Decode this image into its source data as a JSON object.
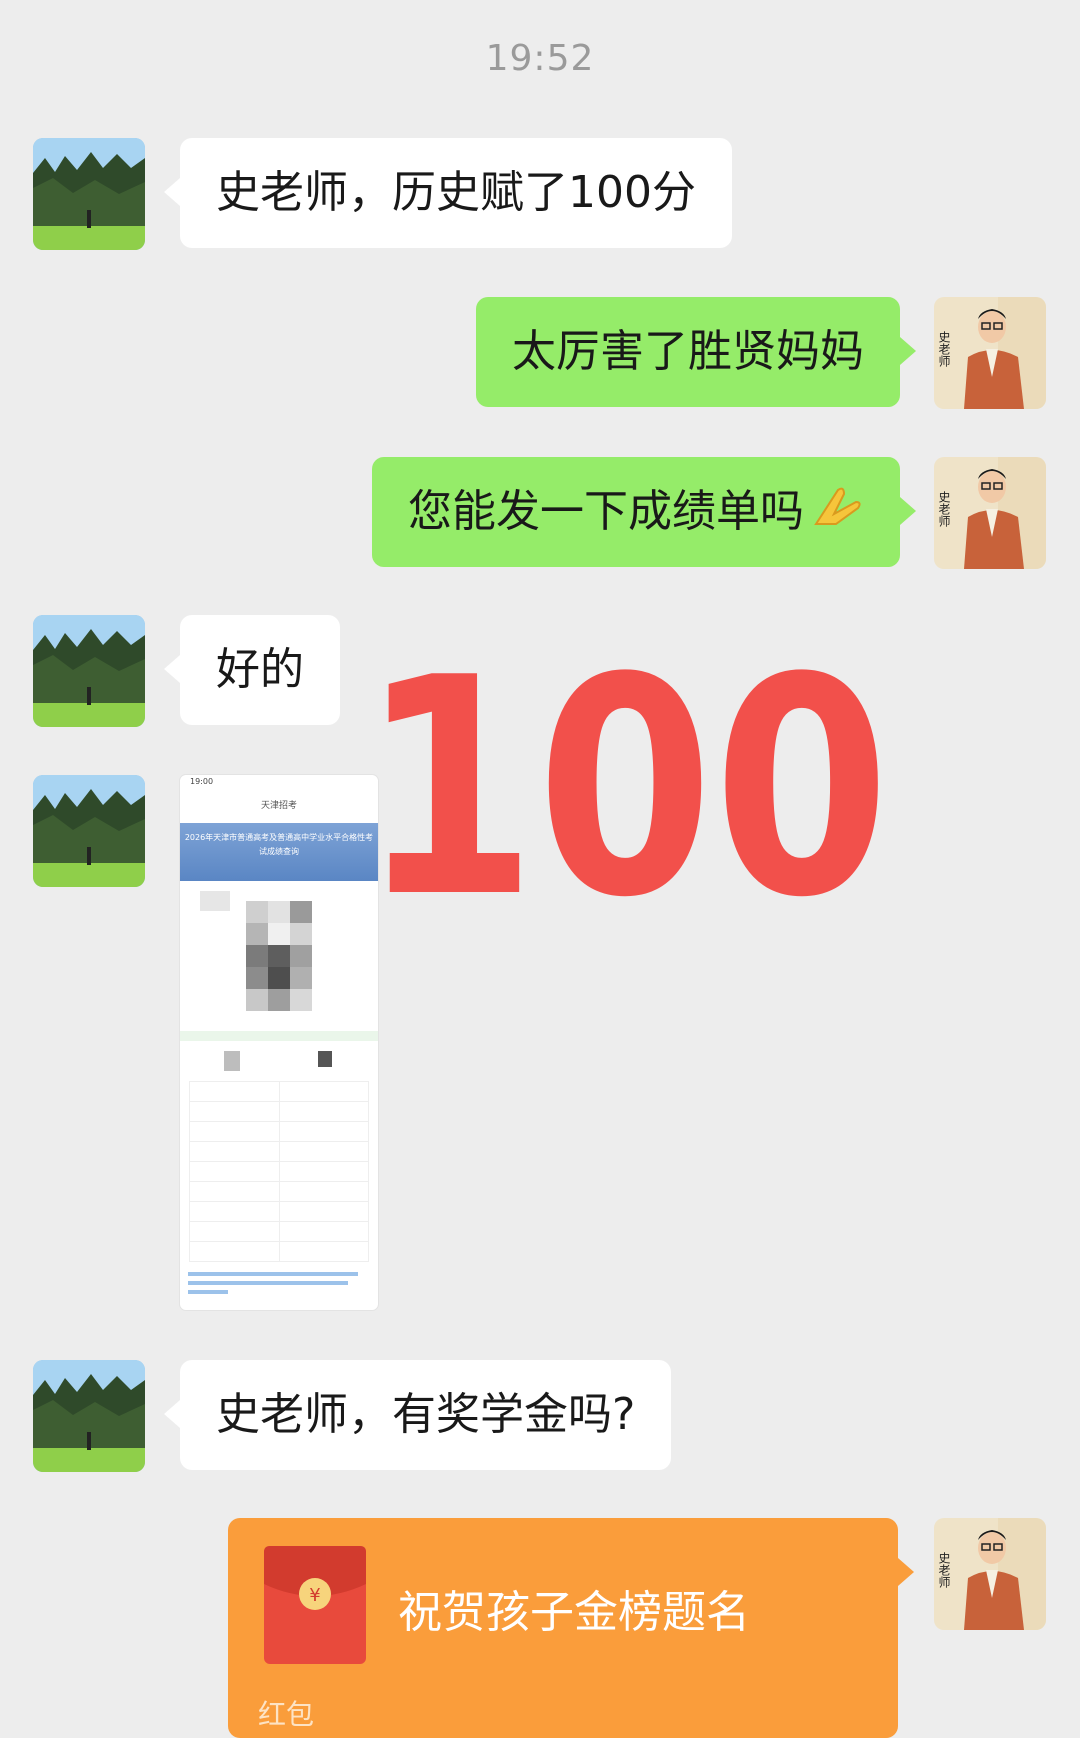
{
  "status": {
    "time": "19:52"
  },
  "messages": [
    {
      "side": "in",
      "text": "史老师，历史赋了100分"
    },
    {
      "side": "out",
      "text": "太厉害了胜贤妈妈"
    },
    {
      "side": "out",
      "text": "您能发一下成绩单吗"
    },
    {
      "side": "in",
      "text": "好的"
    },
    {
      "side": "in",
      "type": "image"
    },
    {
      "side": "in",
      "text": "史老师，有奖学金吗?"
    },
    {
      "side": "out",
      "type": "red-packet"
    }
  ],
  "overlay": {
    "big_number": "100",
    "color": "#f2504b"
  },
  "teacher_avatar": {
    "text": "史老师"
  },
  "red_packet": {
    "title": "祝贺孩子金榜题名",
    "label": "红包",
    "color": "#fa9d3b"
  },
  "screenshot": {
    "status_time": "19:00",
    "title": "天津招考",
    "banner": "2026年天津市普通高考及普通高中学业水平合格性考试成绩查询"
  }
}
